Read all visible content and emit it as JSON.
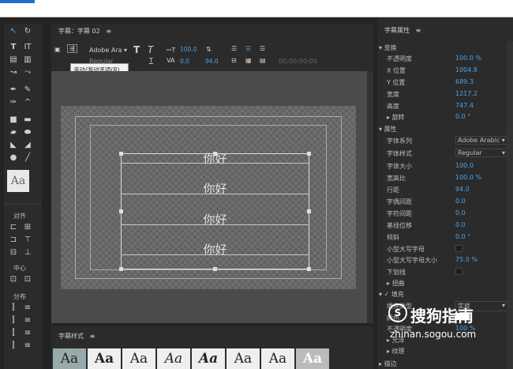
{
  "center": {
    "title": "字幕：字幕 02",
    "menu_glyph": "≡",
    "font_family": "Adobe Ara",
    "font_style": "Regular",
    "size_val": "100.0",
    "kerning_val": "0.0",
    "leading_val": "94.0",
    "timecode": "00;00;00;00",
    "tooltip": "滚动/游动选项(R)...",
    "text_lines": [
      "你好",
      "你好",
      "你好",
      "你好"
    ]
  },
  "tools": {
    "align_label": "对齐",
    "center_label": "中心",
    "distribute_label": "分布",
    "swatch_text": "Aa"
  },
  "styles": {
    "title": "字幕样式",
    "menu_glyph": "≡",
    "swatches": [
      "Aa",
      "Aa",
      "Aa",
      "Aa",
      "Aa",
      "Aa",
      "Aa",
      "Aa"
    ]
  },
  "props": {
    "title": "字幕属性",
    "menu_glyph": "≡",
    "transform": "变换",
    "opacity_label": "不透明度",
    "opacity_val": "100.0 %",
    "x_label": "X 位置",
    "x_val": "1004.8",
    "y_label": "Y 位置",
    "y_val": "689.3",
    "width_label": "宽度",
    "width_val": "1217.2",
    "height_label": "高度",
    "height_val": "747.4",
    "rotate_label": "旋转",
    "rotate_val": "0.0 °",
    "attributes": "属性",
    "font_family_label": "字体系列",
    "font_family_val": "Adobe Arabic",
    "font_style_label": "字体样式",
    "font_style_val": "Regular",
    "font_size_label": "字体大小",
    "font_size_val": "100.0",
    "aspect_label": "宽高比",
    "aspect_val": "100.0 %",
    "leading_label": "行距",
    "leading_val": "94.0",
    "kerning_label": "字偶间距",
    "kerning_val": "0.0",
    "tracking_label": "字符间距",
    "tracking_val": "0.0",
    "baseline_label": "基线位移",
    "baseline_val": "0.0",
    "slant_label": "倾斜",
    "slant_val": "0.0 °",
    "smallcaps_label": "小型大写字母",
    "smallcaps_size_label": "小型大写字母大小",
    "smallcaps_size_val": "75.0 %",
    "underline_label": "下划线",
    "distort_label": "扭曲",
    "fill_label": "填充",
    "fill_type_label": "填充类型",
    "fill_type_val": "实底",
    "fill_color_label": "颜色",
    "fill_opacity_label": "不透明度",
    "fill_opacity_val": "100 %",
    "sheen_label": "光泽",
    "texture_label": "纹理",
    "stroke_label": "描边"
  },
  "watermark": {
    "brand": "搜狗指南",
    "url": "zhinan.sogou.com"
  }
}
